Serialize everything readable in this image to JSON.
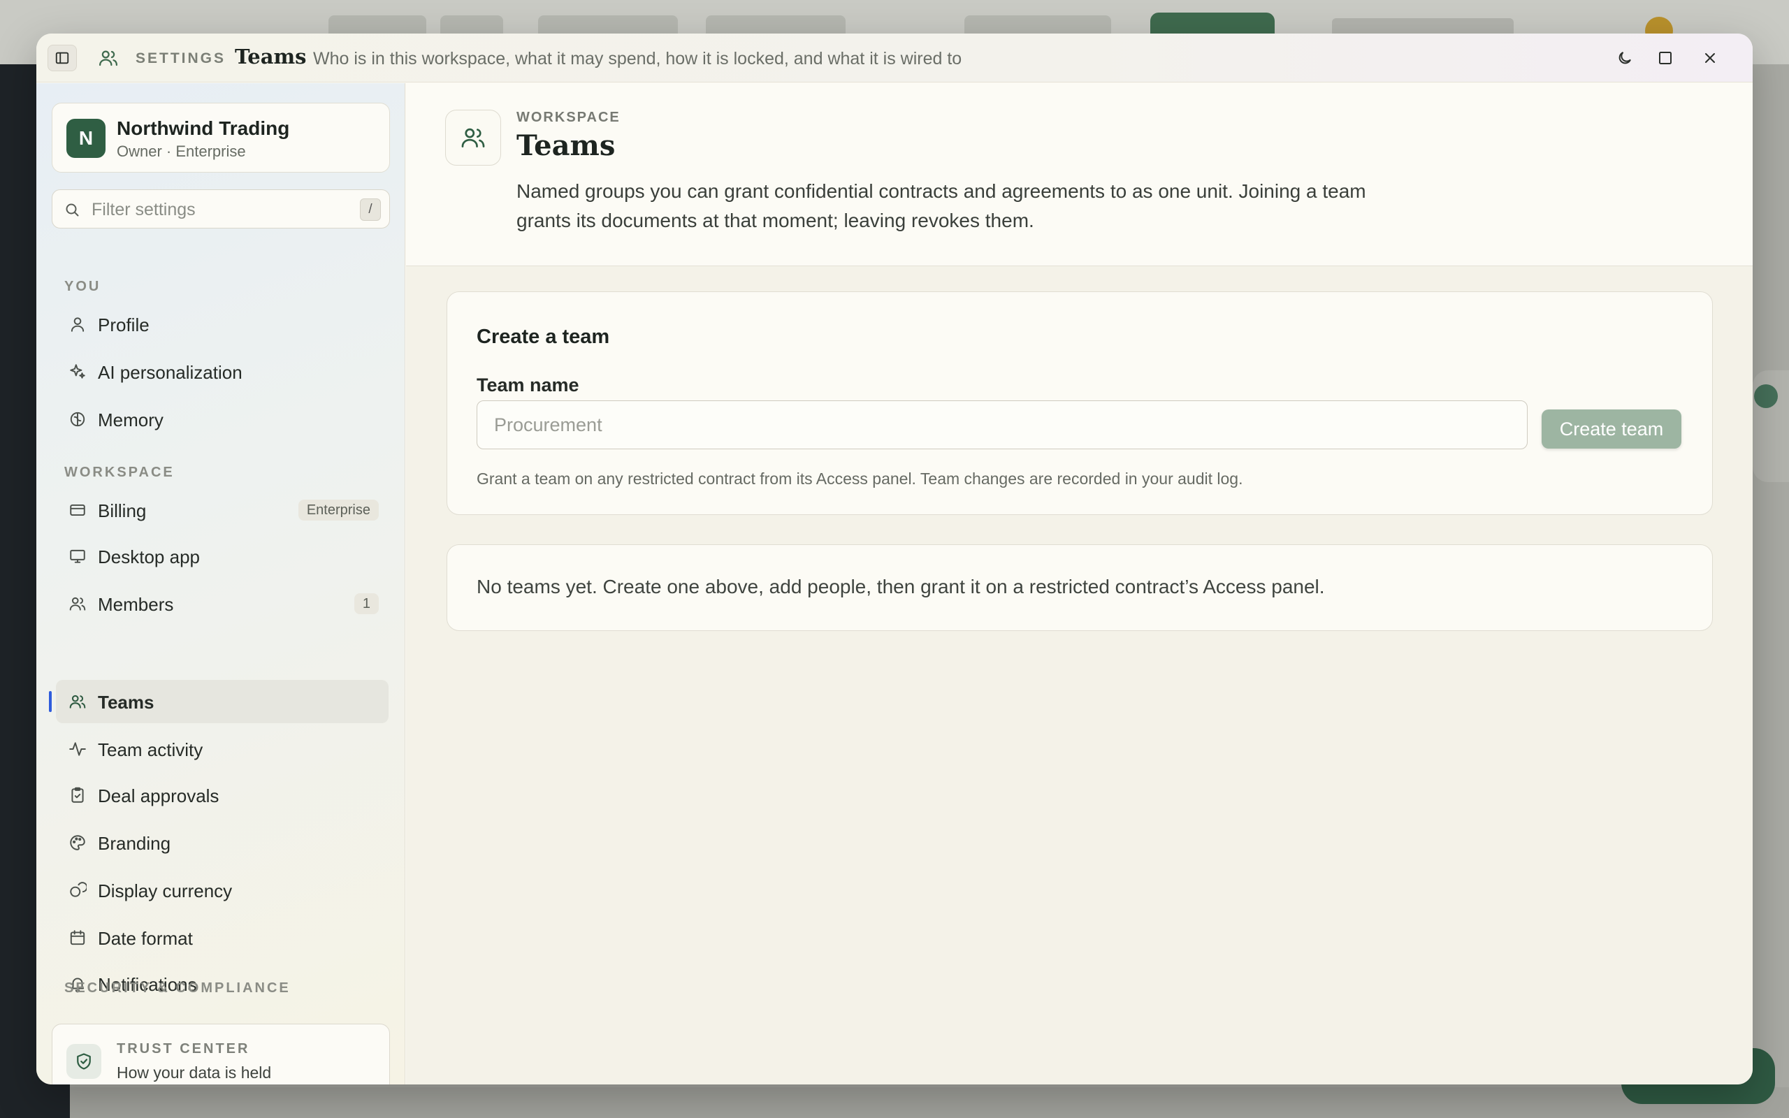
{
  "titlebar": {
    "section": "SETTINGS",
    "title": "Teams",
    "subtitle": "Who is in this workspace, what it may spend, how it is locked, and what it is wired to"
  },
  "workspace": {
    "initial": "N",
    "name": "Northwind Trading",
    "role": "Owner · Enterprise"
  },
  "filter": {
    "placeholder": "Filter settings",
    "shortcut": "/"
  },
  "sidebar": {
    "sections": {
      "you": "YOU",
      "workspace": "WORKSPACE",
      "security": "SECURITY & COMPLIANCE"
    },
    "items": [
      {
        "label": "Profile",
        "icon": "user-icon"
      },
      {
        "label": "AI personalization",
        "icon": "sparkle-icon"
      },
      {
        "label": "Memory",
        "icon": "brain-icon"
      },
      {
        "label": "Billing",
        "icon": "credit-card-icon",
        "badge": "Enterprise"
      },
      {
        "label": "Desktop app",
        "icon": "monitor-icon"
      },
      {
        "label": "Members",
        "icon": "users-icon",
        "badge": "1"
      },
      {
        "label": "Teams",
        "icon": "users-icon",
        "active": true
      },
      {
        "label": "Team activity",
        "icon": "activity-icon"
      },
      {
        "label": "Deal approvals",
        "icon": "clipboard-check-icon"
      },
      {
        "label": "Branding",
        "icon": "palette-icon"
      },
      {
        "label": "Display currency",
        "icon": "coins-icon"
      },
      {
        "label": "Date format",
        "icon": "calendar-icon"
      },
      {
        "label": "Notifications",
        "icon": "bell-icon"
      }
    ]
  },
  "trust": {
    "title": "TRUST CENTER",
    "subtitle": "How your data is held"
  },
  "header": {
    "eyebrow": "WORKSPACE",
    "title": "Teams",
    "description": "Named groups you can grant confidential contracts and agreements to as one unit. Joining a team grants its documents at that moment; leaving revokes them."
  },
  "create": {
    "title": "Create a team",
    "label": "Team name",
    "placeholder": "Procurement",
    "value": "",
    "button": "Create team",
    "hint": "Grant a team on any restricted contract from its Access panel. Team changes are recorded in your audit log."
  },
  "empty": {
    "text": "No teams yet. Create one above, add people, then grant it on a restricted contract’s Access panel."
  },
  "colors": {
    "accent": "#2f5e43",
    "active_indicator": "#2f5cdc",
    "button_disabled": "#9db5a2"
  }
}
